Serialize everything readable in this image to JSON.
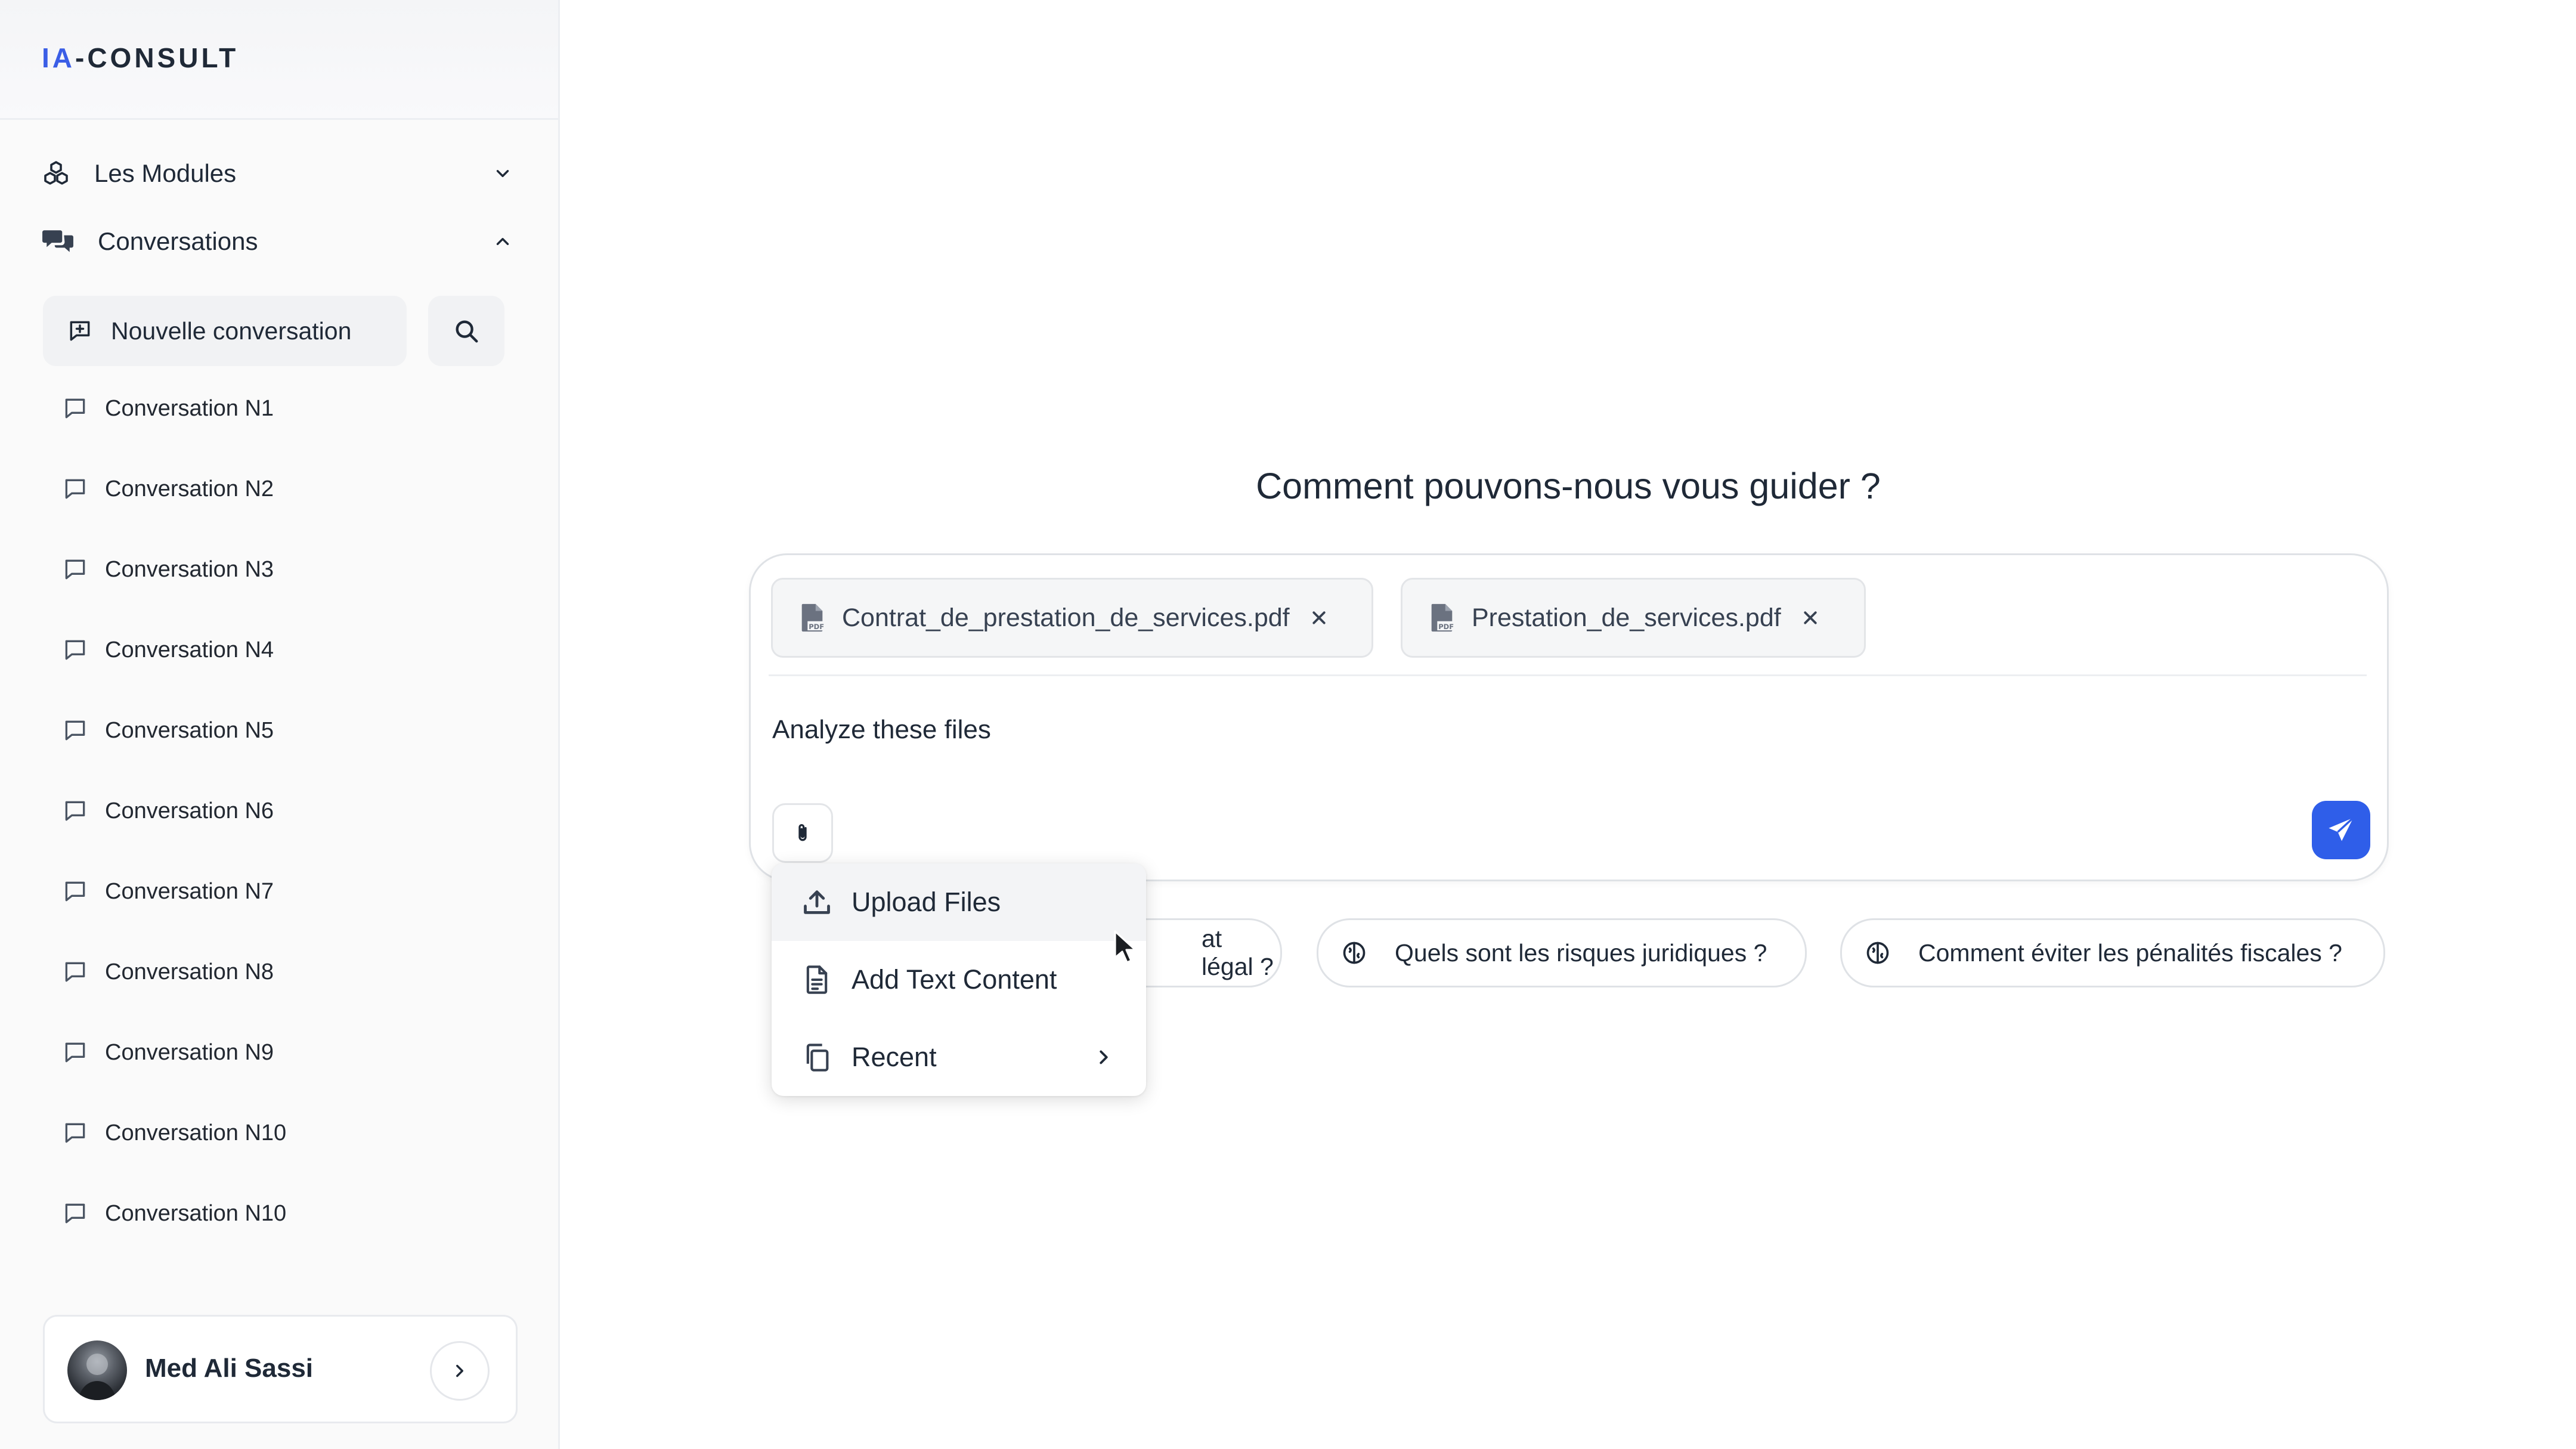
{
  "app": {
    "logo_prefix": "IA",
    "logo_suffix": "-CONSULT",
    "accent_color": "#3b5ee6"
  },
  "sidebar": {
    "modules_label": "Les Modules",
    "conversations_label": "Conversations",
    "new_conversation_label": "Nouvelle conversation",
    "conversations": [
      "Conversation N1",
      "Conversation N2",
      "Conversation N3",
      "Conversation N4",
      "Conversation N5",
      "Conversation N6",
      "Conversation N7",
      "Conversation N8",
      "Conversation N9",
      "Conversation N10",
      "Conversation N10"
    ],
    "user": {
      "name": "Med Ali Sassi"
    }
  },
  "main": {
    "headline": "Comment pouvons-nous vous guider ?",
    "attachments": [
      {
        "name": "Contrat_de_prestation_de_services.pdf",
        "icon": "pdf-file-icon"
      },
      {
        "name": "Prestation_de_services.pdf",
        "icon": "pdf-file-icon"
      }
    ],
    "message": "Analyze these files",
    "send_color": "#2f5ee9",
    "suggestions": [
      "at légal ?",
      "Quels sont les risques juridiques ?",
      "Comment éviter les pénalités fiscales ?"
    ]
  },
  "attach_menu": {
    "items": [
      {
        "label": "Upload Files",
        "icon": "upload-icon",
        "active": true
      },
      {
        "label": "Add Text Content",
        "icon": "document-icon"
      },
      {
        "label": "Recent",
        "icon": "copy-icon",
        "has_submenu": true
      }
    ]
  }
}
